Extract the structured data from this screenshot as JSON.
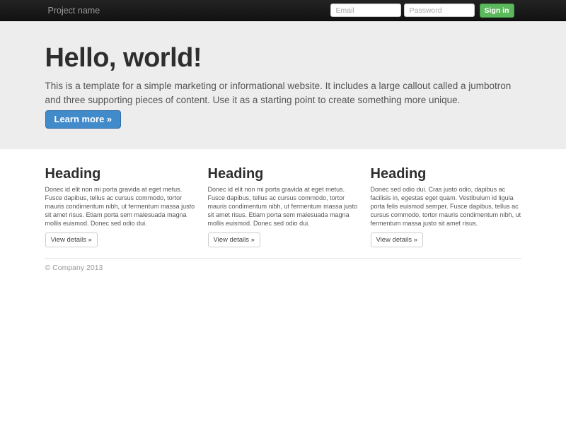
{
  "navbar": {
    "brand": "Project name",
    "email_placeholder": "Email",
    "password_placeholder": "Password",
    "signin_label": "Sign in"
  },
  "jumbotron": {
    "title": "Hello, world!",
    "description": "This is a template for a simple marketing or informational website. It includes a large callout called a jumbotron and three supporting pieces of content. Use it as a starting point to create something more unique.",
    "cta_label": "Learn more »"
  },
  "columns": [
    {
      "heading": "Heading",
      "text": "Donec id elit non mi porta gravida at eget metus. Fusce dapibus, tellus ac cursus commodo, tortor mauris condimentum nibh, ut fermentum massa justo sit amet risus. Etiam porta sem malesuada magna mollis euismod. Donec sed odio dui.",
      "button_label": "View details »"
    },
    {
      "heading": "Heading",
      "text": "Donec id elit non mi porta gravida at eget metus. Fusce dapibus, tellus ac cursus commodo, tortor mauris condimentum nibh, ut fermentum massa justo sit amet risus. Etiam porta sem malesuada magna mollis euismod. Donec sed odio dui.",
      "button_label": "View details »"
    },
    {
      "heading": "Heading",
      "text": "Donec sed odio dui. Cras justo odio, dapibus ac facilisis in, egestas eget quam. Vestibulum id ligula porta felis euismod semper. Fusce dapibus, tellus ac cursus commodo, tortor mauris condimentum nibh, ut fermentum massa justo sit amet risus.",
      "button_label": "View details »"
    }
  ],
  "footer": {
    "copyright": "© Company 2013"
  },
  "colors": {
    "navbar_bg": "#1b1b1b",
    "jumbotron_bg": "#ededed",
    "primary": "#428bca",
    "success": "#5cb85c"
  }
}
